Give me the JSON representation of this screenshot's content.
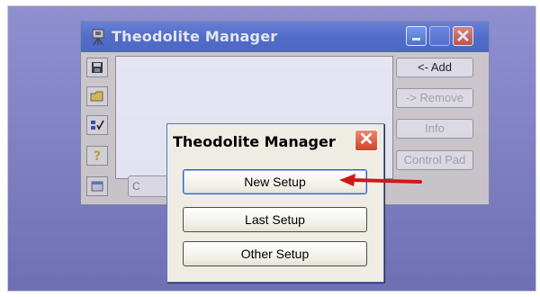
{
  "main_window": {
    "title": "Theodolite Manager",
    "right_buttons": [
      "<- Add",
      "-> Remove",
      "Info",
      "Control Pad"
    ],
    "bottom_button_label": "C",
    "toolbar_icons": [
      "save-icon",
      "open-folder-icon",
      "check-icon",
      "help-icon",
      "window-icon"
    ]
  },
  "dialog": {
    "title": "Theodolite Manager",
    "buttons": [
      "New Setup",
      "Last Setup",
      "Other Setup"
    ]
  },
  "colors": {
    "desktop": "#8383c6",
    "title_bar": "#4265c8",
    "close_button": "#cc432a",
    "arrow": "#d01818"
  }
}
